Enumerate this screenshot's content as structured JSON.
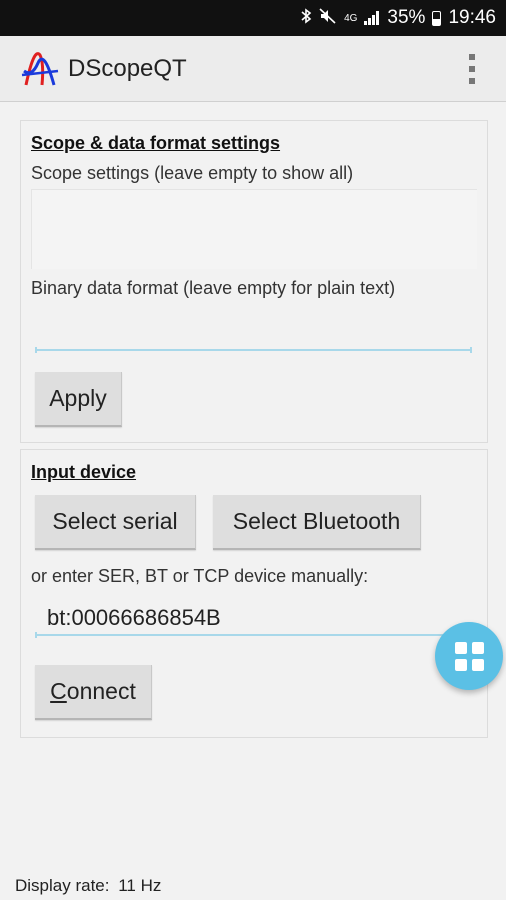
{
  "status_bar": {
    "bluetooth_icon": "bluetooth-icon",
    "mute_icon": "mute-icon",
    "network_label": "4G",
    "battery_percent": "35%",
    "time": "19:46"
  },
  "app_bar": {
    "title": "DScopeQT",
    "logo_icon": "dscope-logo-icon",
    "menu_icon": "overflow-menu-icon"
  },
  "scope_panel": {
    "title": "Scope & data format settings",
    "scope_settings_label": "Scope settings (leave empty to show all)",
    "scope_settings_value": "",
    "binary_format_label": "Binary data format (leave empty for plain text)",
    "binary_format_value": "",
    "apply_label": "Apply"
  },
  "input_panel": {
    "title": "Input device",
    "select_serial_label": "Select serial",
    "select_bluetooth_label": "Select Bluetooth",
    "manual_label": "or enter SER, BT or TCP device manually:",
    "device_value": "bt:00066686854B",
    "connect_label_first": "C",
    "connect_label_rest": "onnect"
  },
  "fab": {
    "icon": "grid-apps-icon"
  },
  "footer": {
    "display_rate_label": "Display rate:",
    "display_rate_value": "11 Hz"
  },
  "colors": {
    "status_bar": "#111111",
    "app_bar": "#ececec",
    "fab": "#5bc0e5",
    "input_underline": "#a8d8ea",
    "logo_red": "#e02020",
    "logo_blue": "#1a3adb"
  }
}
